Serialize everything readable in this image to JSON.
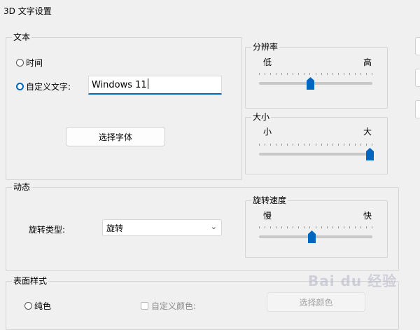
{
  "window": {
    "title": "3D 文字设置"
  },
  "text_group": {
    "label": "文本",
    "time_option": "时间",
    "custom_option": "自定义文字:",
    "custom_value": "Windows 11",
    "choose_font_button": "选择字体"
  },
  "resolution_group": {
    "label": "分辨率",
    "low": "低",
    "high": "高",
    "value_fraction": 0.45
  },
  "size_group": {
    "label": "大小",
    "small": "小",
    "large": "大",
    "value_fraction": 1.0
  },
  "motion_group": {
    "label": "动态",
    "rotation_type_label": "旋转类型:",
    "rotation_type_value": "旋转"
  },
  "speed_group": {
    "label": "旋转速度",
    "slow": "慢",
    "fast": "快",
    "value_fraction": 0.46
  },
  "surface_group": {
    "label": "表面样式",
    "solid_color_option": "纯色",
    "custom_color_option": "自定义颜色:",
    "choose_color_button": "选择颜色"
  },
  "watermark": {
    "text": "Bai du 经验"
  },
  "colors": {
    "accent": "#0067c0"
  }
}
